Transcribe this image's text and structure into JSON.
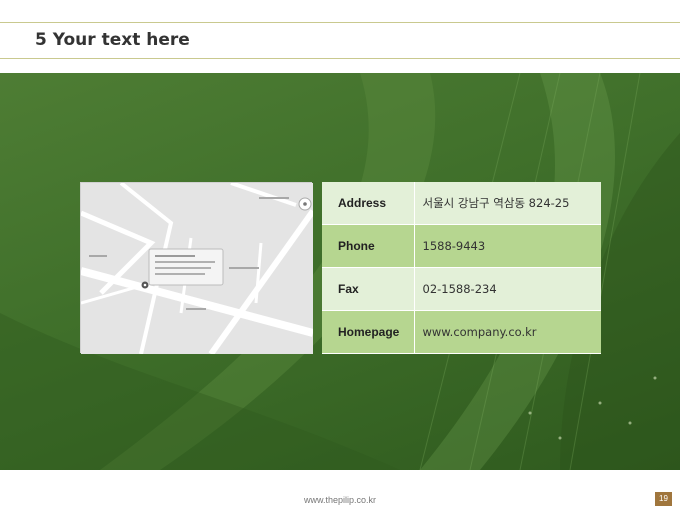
{
  "slide": {
    "title": "5 Your text here"
  },
  "contact": {
    "rows": [
      {
        "label": "Address",
        "value": "서울시 강남구 역삼동 824-25"
      },
      {
        "label": "Phone",
        "value": "1588-9443"
      },
      {
        "label": "Fax",
        "value": "02-1588-234"
      },
      {
        "label": "Homepage",
        "value": "www.company.co.kr"
      }
    ]
  },
  "footer": {
    "url": "www.thepilip.co.kr",
    "page_number": "19"
  },
  "colors": {
    "background_green": "#3f6f2a",
    "row_light": "#e3f0d8",
    "row_dark": "#b6d690",
    "page_badge": "#a0763d",
    "title_rule": "#c9c98f"
  },
  "icons": {
    "map_pin": "location-pin-icon",
    "map_compass": "compass-icon"
  }
}
